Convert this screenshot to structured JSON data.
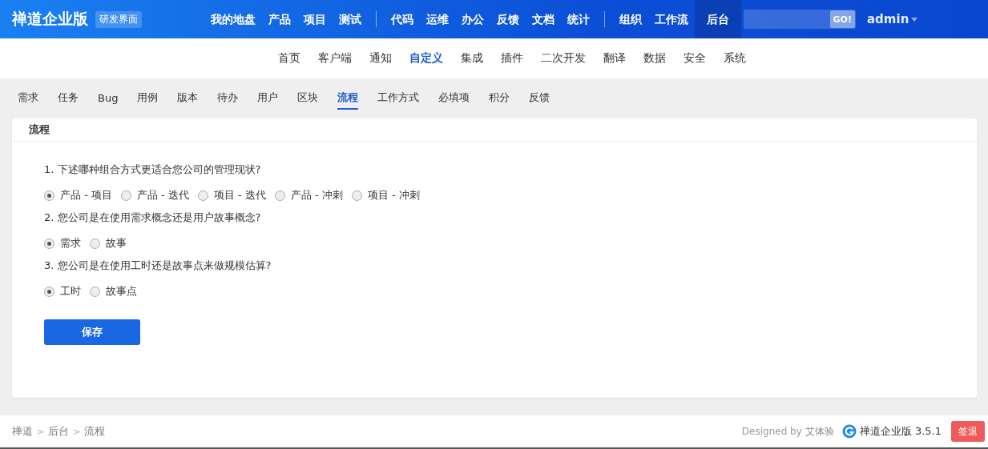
{
  "brand": {
    "title": "禅道企业版",
    "badge": "研发界面"
  },
  "nav_groups": [
    [
      {
        "label": "我的地盘",
        "selected": false
      },
      {
        "label": "产品",
        "selected": false
      },
      {
        "label": "项目",
        "selected": false
      },
      {
        "label": "测试",
        "selected": false
      }
    ],
    [
      {
        "label": "代码",
        "selected": false
      },
      {
        "label": "运维",
        "selected": false
      },
      {
        "label": "办公",
        "selected": false
      },
      {
        "label": "反馈",
        "selected": false
      },
      {
        "label": "文档",
        "selected": false
      },
      {
        "label": "统计",
        "selected": false
      }
    ],
    [
      {
        "label": "组织",
        "selected": false
      },
      {
        "label": "工作流",
        "selected": false
      },
      {
        "label": "后台",
        "selected": true
      }
    ]
  ],
  "search": {
    "button": "GO!"
  },
  "user": "admin",
  "sub_nav": [
    {
      "label": "首页",
      "selected": false
    },
    {
      "label": "客户端",
      "selected": false
    },
    {
      "label": "通知",
      "selected": false
    },
    {
      "label": "自定义",
      "selected": true
    },
    {
      "label": "集成",
      "selected": false
    },
    {
      "label": "插件",
      "selected": false
    },
    {
      "label": "二次开发",
      "selected": false
    },
    {
      "label": "翻译",
      "selected": false
    },
    {
      "label": "数据",
      "selected": false
    },
    {
      "label": "安全",
      "selected": false
    },
    {
      "label": "系统",
      "selected": false
    }
  ],
  "tabs": [
    {
      "label": "需求",
      "selected": false
    },
    {
      "label": "任务",
      "selected": false
    },
    {
      "label": "Bug",
      "selected": false
    },
    {
      "label": "用例",
      "selected": false
    },
    {
      "label": "版本",
      "selected": false
    },
    {
      "label": "待办",
      "selected": false
    },
    {
      "label": "用户",
      "selected": false
    },
    {
      "label": "区块",
      "selected": false
    },
    {
      "label": "流程",
      "selected": true
    },
    {
      "label": "工作方式",
      "selected": false
    },
    {
      "label": "必填项",
      "selected": false
    },
    {
      "label": "积分",
      "selected": false
    },
    {
      "label": "反馈",
      "selected": false
    }
  ],
  "panel": {
    "title": "流程",
    "questions": [
      {
        "text": "1. 下述哪种组合方式更适合您公司的管理现状?",
        "options": [
          {
            "label": "产品 - 项目",
            "selected": true
          },
          {
            "label": "产品 - 迭代",
            "selected": false
          },
          {
            "label": "项目 - 迭代",
            "selected": false
          },
          {
            "label": "产品 - 冲刺",
            "selected": false
          },
          {
            "label": "项目 - 冲刺",
            "selected": false
          }
        ]
      },
      {
        "text": "2. 您公司是在使用需求概念还是用户故事概念?",
        "options": [
          {
            "label": "需求",
            "selected": true
          },
          {
            "label": "故事",
            "selected": false
          }
        ]
      },
      {
        "text": "3. 您公司是在使用工时还是故事点来做规模估算?",
        "options": [
          {
            "label": "工时",
            "selected": true
          },
          {
            "label": "故事点",
            "selected": false
          }
        ]
      }
    ],
    "save": "保存"
  },
  "breadcrumb": [
    {
      "kind": "link",
      "text": "禅道"
    },
    {
      "kind": "separator",
      "text": ">"
    },
    {
      "kind": "link",
      "text": "后台"
    },
    {
      "kind": "separator",
      "text": ">"
    },
    {
      "kind": "link",
      "text": "流程"
    }
  ],
  "footer": {
    "designed_by": "Designed by",
    "designer": "艾体验",
    "product": "禅道企业版 3.5.1",
    "logout": "签退"
  }
}
